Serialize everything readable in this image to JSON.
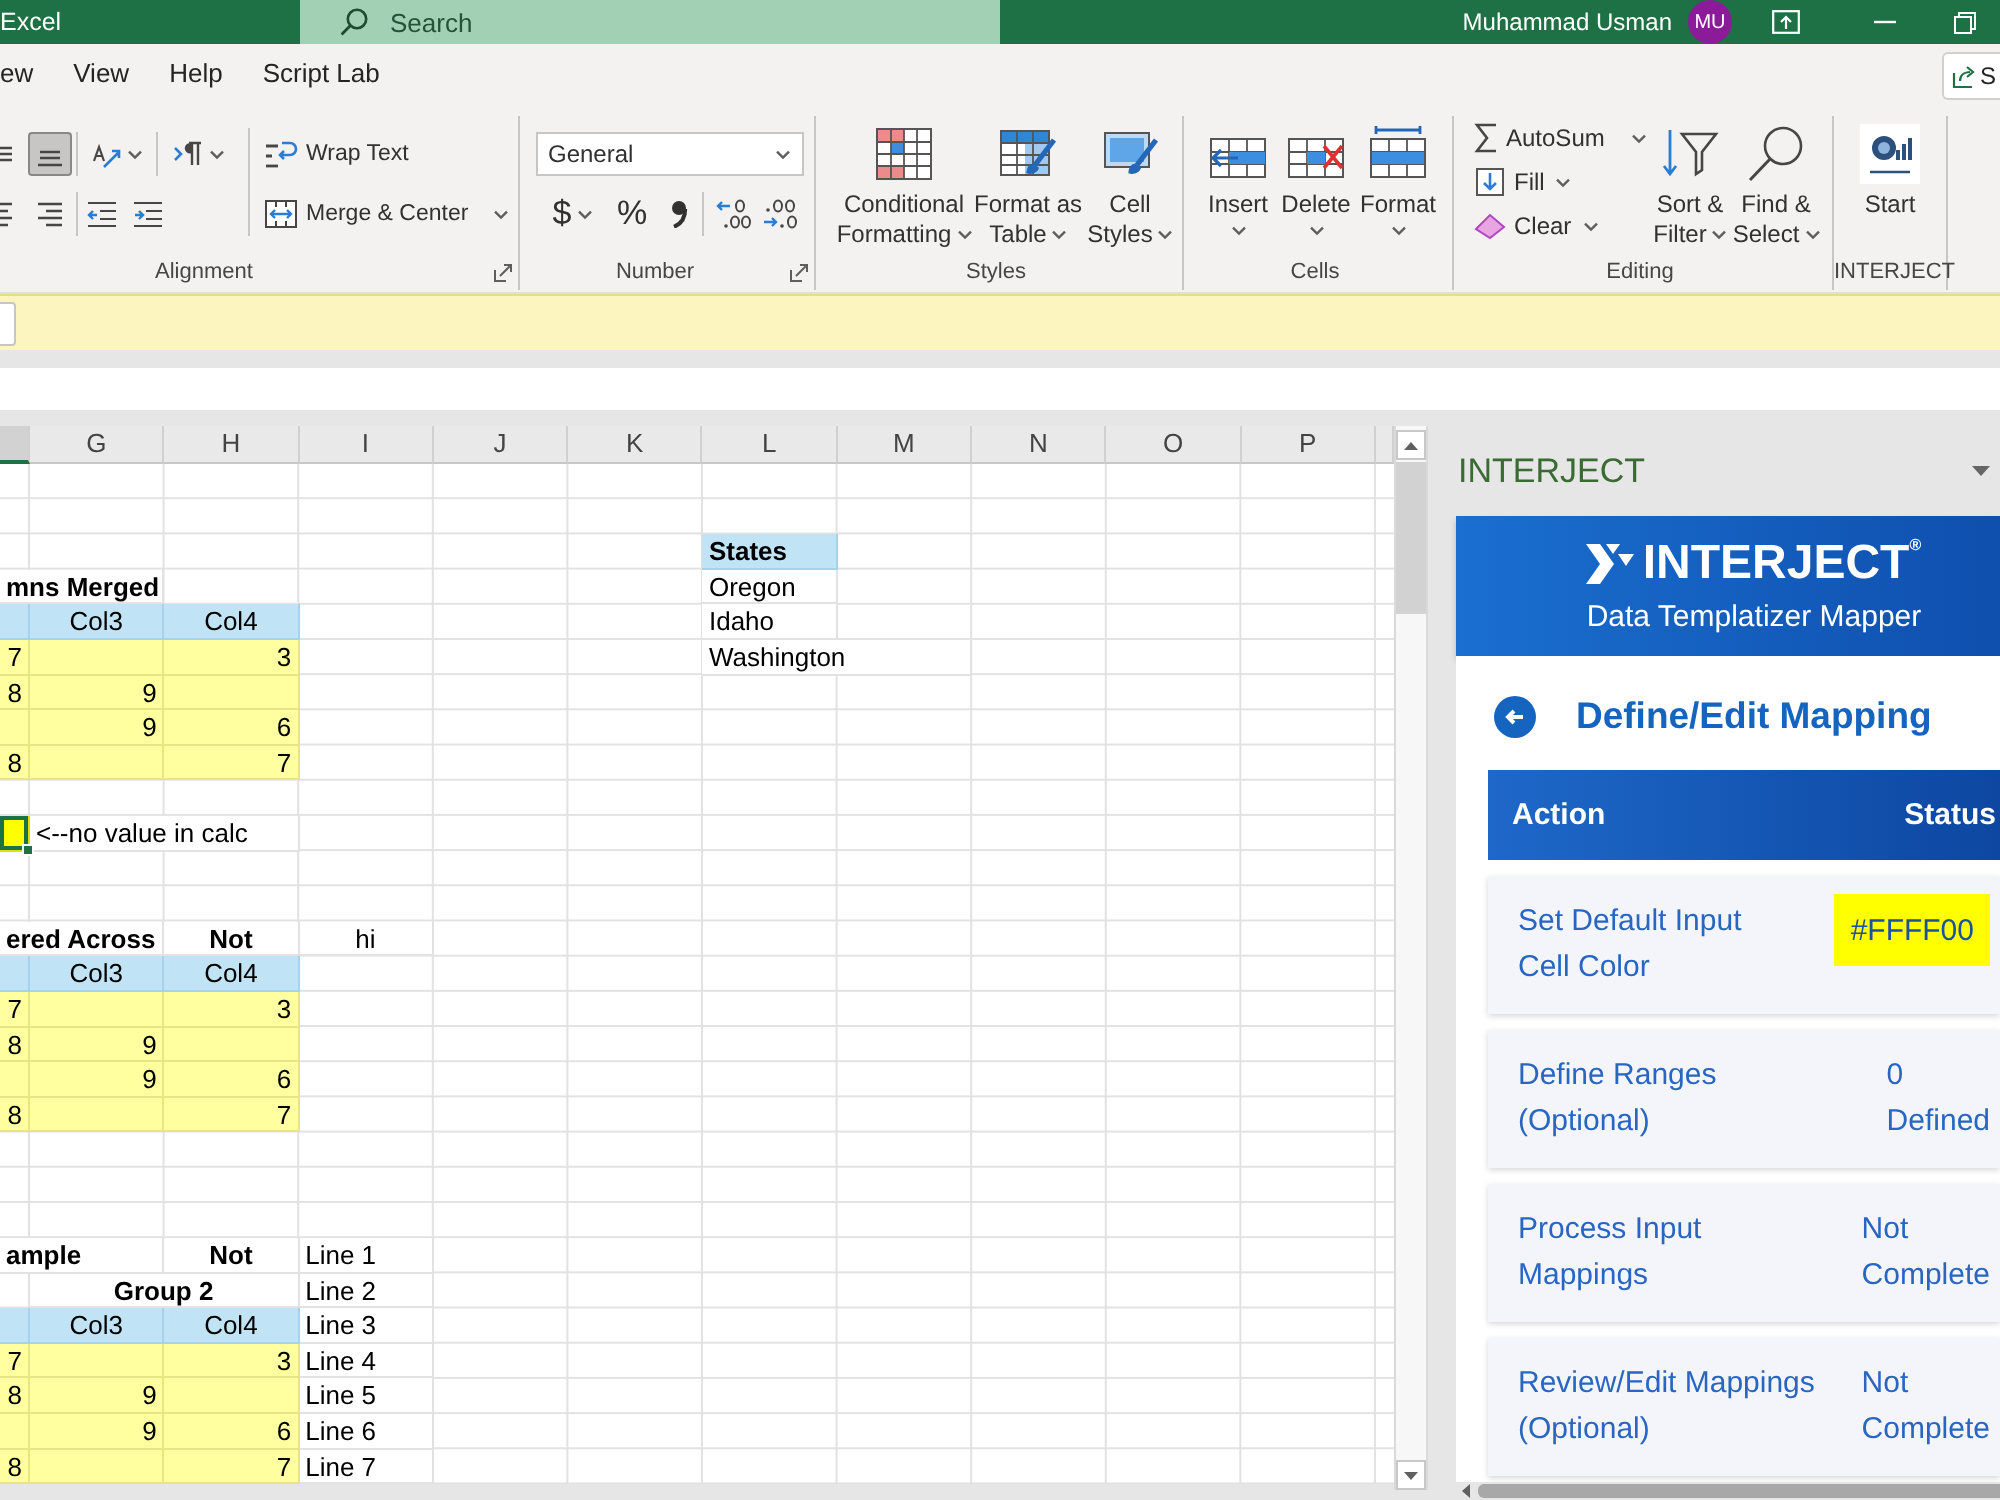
{
  "title_bar": {
    "app_name": "Excel",
    "search": {
      "placeholder": "Search"
    },
    "user_name": "Muhammad Usman",
    "avatar_initials": "MU"
  },
  "menu": {
    "tabs": [
      {
        "label": "ew",
        "selected": false
      },
      {
        "label": "View",
        "selected": false
      },
      {
        "label": "Help",
        "selected": false
      },
      {
        "label": "Script Lab",
        "selected": false
      }
    ],
    "share_button": "S"
  },
  "ribbon": {
    "alignment": {
      "label": "Alignment",
      "top_buttons": [
        {
          "selected": false
        },
        {
          "selected": true
        },
        {
          "selected": false
        },
        {
          "selected": false
        }
      ],
      "bottom_buttons": [
        {
          "selected": false
        },
        {
          "selected": false
        },
        {
          "selected": false
        },
        {
          "selected": false
        }
      ],
      "wrap_text": "Wrap Text",
      "merge": "Merge & Center"
    },
    "number": {
      "label": "Number",
      "format": "General",
      "currency": "$",
      "percent": "%"
    },
    "styles": {
      "label": "Styles",
      "buttons": [
        "Conditional Formatting",
        "Format as Table",
        "Cell Styles"
      ]
    },
    "cells": {
      "label": "Cells",
      "buttons": [
        "Insert",
        "Delete",
        "Format"
      ]
    },
    "editing": {
      "label": "Editing",
      "small_buttons": [
        "AutoSum",
        "Fill",
        "Clear"
      ],
      "buttons": [
        "Sort & Filter",
        "Find & Select"
      ]
    },
    "add_in": {
      "label": "INTERJECT",
      "button": "Start"
    }
  },
  "sheet": {
    "edge_column": {
      "selected": true
    },
    "columns": [
      {
        "label": "G",
        "selected": false
      },
      {
        "label": "H",
        "selected": false
      },
      {
        "label": "I",
        "selected": false
      },
      {
        "label": "J",
        "selected": false
      },
      {
        "label": "K",
        "selected": false
      },
      {
        "label": "L",
        "selected": false
      },
      {
        "label": "M",
        "selected": false
      },
      {
        "label": "N",
        "selected": false
      },
      {
        "label": "O",
        "selected": false
      },
      {
        "label": "P",
        "selected": false
      }
    ],
    "rows": [
      {},
      {},
      {
        "l": {
          "text": "States",
          "kind": "list-header",
          "selected": false
        }
      },
      {
        "edge": {
          "text": "mns Merged",
          "kind": "title",
          "selected": false
        },
        "l": {
          "text": "Oregon",
          "kind": "text",
          "selected": false
        }
      },
      {
        "edge": {
          "kind": "header",
          "selected": false
        },
        "g": {
          "text": "Col3",
          "kind": "header",
          "selected": false
        },
        "h": {
          "text": "Col4",
          "kind": "header",
          "selected": false
        },
        "l": {
          "text": "Idaho",
          "kind": "text",
          "selected": false
        }
      },
      {
        "edge": {
          "text": "7",
          "kind": "input",
          "selected": false
        },
        "g": {
          "kind": "input",
          "selected": false
        },
        "h": {
          "text": "3",
          "kind": "input",
          "selected": false
        },
        "l": {
          "text": "Washington",
          "kind": "note",
          "selected": false
        }
      },
      {
        "edge": {
          "text": "8",
          "kind": "input",
          "selected": false
        },
        "g": {
          "text": "9",
          "kind": "input",
          "selected": false
        },
        "h": {
          "kind": "input",
          "selected": false
        }
      },
      {
        "edge": {
          "kind": "input",
          "selected": false
        },
        "g": {
          "text": "9",
          "kind": "input",
          "selected": false
        },
        "h": {
          "text": "6",
          "kind": "input",
          "selected": false
        }
      },
      {
        "edge": {
          "text": "8",
          "kind": "input",
          "selected": false
        },
        "g": {
          "kind": "input",
          "selected": false
        },
        "h": {
          "text": "7",
          "kind": "input",
          "selected": false
        }
      },
      {},
      {
        "edge": {
          "kind": "marked",
          "selected": true
        },
        "g": {
          "text": "<--no value in calc",
          "kind": "note",
          "selected": false
        }
      },
      {},
      {},
      {
        "edge": {
          "text": "ered Across",
          "kind": "title",
          "selected": false
        },
        "h": {
          "text": "Not",
          "kind": "label",
          "selected": false
        },
        "i": {
          "text": "hi",
          "kind": "centered",
          "selected": false
        }
      },
      {
        "edge": {
          "kind": "header",
          "selected": false
        },
        "g": {
          "text": "Col3",
          "kind": "header",
          "selected": false
        },
        "h": {
          "text": "Col4",
          "kind": "header",
          "selected": false
        }
      },
      {
        "edge": {
          "text": "7",
          "kind": "input",
          "selected": false
        },
        "g": {
          "kind": "input",
          "selected": false
        },
        "h": {
          "text": "3",
          "kind": "input",
          "selected": false
        }
      },
      {
        "edge": {
          "text": "8",
          "kind": "input",
          "selected": false
        },
        "g": {
          "text": "9",
          "kind": "input",
          "selected": false
        },
        "h": {
          "kind": "input",
          "selected": false
        }
      },
      {
        "edge": {
          "kind": "input",
          "selected": false
        },
        "g": {
          "text": "9",
          "kind": "input",
          "selected": false
        },
        "h": {
          "text": "6",
          "kind": "input",
          "selected": false
        }
      },
      {
        "edge": {
          "text": "8",
          "kind": "input",
          "selected": false
        },
        "g": {
          "kind": "input",
          "selected": false
        },
        "h": {
          "text": "7",
          "kind": "input",
          "selected": false
        }
      },
      {},
      {},
      {},
      {
        "edge": {
          "text": "ample",
          "kind": "title",
          "selected": false
        },
        "h": {
          "text": "Not",
          "kind": "label",
          "selected": false
        },
        "i": {
          "text": "Line 1",
          "kind": "text",
          "selected": false
        }
      },
      {
        "g": {
          "text": "Group 2",
          "kind": "group",
          "selected": false
        },
        "i": {
          "text": "Line 2",
          "kind": "text",
          "selected": false
        }
      },
      {
        "edge": {
          "kind": "header",
          "selected": false
        },
        "g": {
          "text": "Col3",
          "kind": "header",
          "selected": false
        },
        "h": {
          "text": "Col4",
          "kind": "header",
          "selected": false
        },
        "i": {
          "text": "Line 3",
          "kind": "text",
          "selected": false
        }
      },
      {
        "edge": {
          "text": "7",
          "kind": "input",
          "selected": false
        },
        "g": {
          "kind": "input",
          "selected": false
        },
        "h": {
          "text": "3",
          "kind": "input",
          "selected": false
        },
        "i": {
          "text": "Line 4",
          "kind": "text",
          "selected": false
        }
      },
      {
        "edge": {
          "text": "8",
          "kind": "input",
          "selected": false
        },
        "g": {
          "text": "9",
          "kind": "input",
          "selected": false
        },
        "h": {
          "kind": "input",
          "selected": false
        },
        "i": {
          "text": "Line 5",
          "kind": "text",
          "selected": false
        }
      },
      {
        "edge": {
          "kind": "input",
          "selected": false
        },
        "g": {
          "text": "9",
          "kind": "input",
          "selected": false
        },
        "h": {
          "text": "6",
          "kind": "input",
          "selected": false
        },
        "i": {
          "text": "Line 6",
          "kind": "text",
          "selected": false
        }
      },
      {
        "edge": {
          "text": "8",
          "kind": "input",
          "selected": false
        },
        "g": {
          "kind": "input",
          "selected": false
        },
        "h": {
          "text": "7",
          "kind": "input",
          "selected": false
        },
        "i": {
          "text": "Line 7",
          "kind": "text",
          "selected": false
        }
      }
    ]
  },
  "task_pane": {
    "title": "INTERJECT",
    "header": {
      "brand": "INTERJECT$^{®}$",
      "subtitle": "Data Templatizer Mapper"
    },
    "page_title": "Define/Edit Mapping",
    "table": {
      "columns": [
        "Action",
        "Status"
      ],
      "rows": [
        {
          "action": "Set Default Input Cell Color",
          "status": "#FFFF00",
          "color": "#ffff00"
        },
        {
          "action": "Define Ranges (Optional)",
          "status": "0 Defined"
        },
        {
          "action": "Process Input Mappings",
          "status": "Not Complete"
        },
        {
          "action": "Review/Edit Mappings (Optional)",
          "status": "Not Complete"
        }
      ]
    }
  }
}
